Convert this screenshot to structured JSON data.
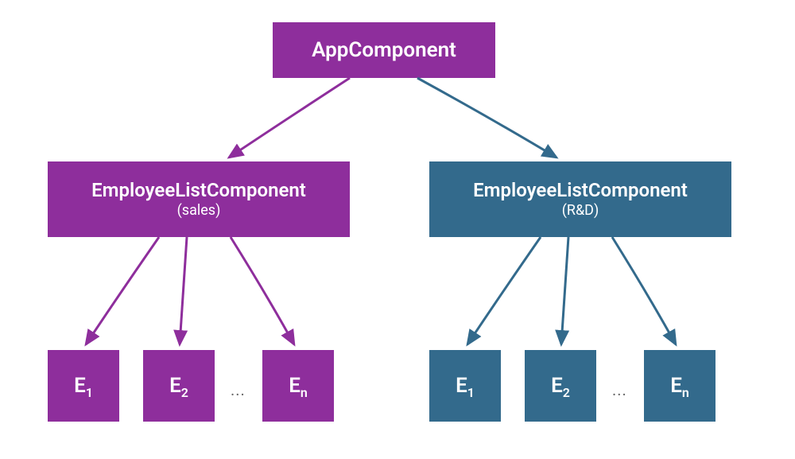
{
  "colors": {
    "purple": "#8E2E9C",
    "blue": "#336A8C"
  },
  "root": {
    "label": "AppComponent"
  },
  "lists": {
    "left": {
      "title": "EmployeeListComponent",
      "subtitle": "(sales)"
    },
    "right": {
      "title": "EmployeeListComponent",
      "subtitle": "(R&D)"
    }
  },
  "leaf_labels": {
    "e": "E",
    "sub1": "1",
    "sub2": "2",
    "subn": "n",
    "ellipsis": "..."
  },
  "chart_data": {
    "type": "tree",
    "title": "",
    "nodes": [
      {
        "id": "app",
        "label": "AppComponent",
        "color": "purple"
      },
      {
        "id": "list-sales",
        "label": "EmployeeListComponent (sales)",
        "color": "purple",
        "parent": "app"
      },
      {
        "id": "list-rnd",
        "label": "EmployeeListComponent (R&D)",
        "color": "blue",
        "parent": "app"
      },
      {
        "id": "sales-e1",
        "label": "E1",
        "color": "purple",
        "parent": "list-sales"
      },
      {
        "id": "sales-e2",
        "label": "E2",
        "color": "purple",
        "parent": "list-sales"
      },
      {
        "id": "sales-ellipsis",
        "label": "...",
        "color": "none",
        "parent": "list-sales"
      },
      {
        "id": "sales-en",
        "label": "En",
        "color": "purple",
        "parent": "list-sales"
      },
      {
        "id": "rnd-e1",
        "label": "E1",
        "color": "blue",
        "parent": "list-rnd"
      },
      {
        "id": "rnd-e2",
        "label": "E2",
        "color": "blue",
        "parent": "list-rnd"
      },
      {
        "id": "rnd-ellipsis",
        "label": "...",
        "color": "none",
        "parent": "list-rnd"
      },
      {
        "id": "rnd-en",
        "label": "En",
        "color": "blue",
        "parent": "list-rnd"
      }
    ],
    "edges": [
      {
        "from": "app",
        "to": "list-sales",
        "color": "purple"
      },
      {
        "from": "app",
        "to": "list-rnd",
        "color": "blue"
      },
      {
        "from": "list-sales",
        "to": "sales-e1",
        "color": "purple"
      },
      {
        "from": "list-sales",
        "to": "sales-e2",
        "color": "purple"
      },
      {
        "from": "list-sales",
        "to": "sales-en",
        "color": "purple"
      },
      {
        "from": "list-rnd",
        "to": "rnd-e1",
        "color": "blue"
      },
      {
        "from": "list-rnd",
        "to": "rnd-e2",
        "color": "blue"
      },
      {
        "from": "list-rnd",
        "to": "rnd-en",
        "color": "blue"
      }
    ]
  }
}
